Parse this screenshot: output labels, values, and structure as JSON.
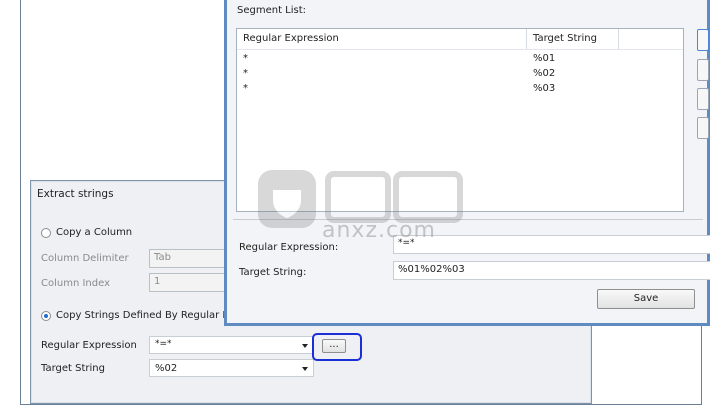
{
  "extract_panel": {
    "title": "Extract strings",
    "copy_column": {
      "label": "Copy a Column",
      "selected": false,
      "column_delimiter": {
        "label": "Column Delimiter",
        "value": "Tab"
      },
      "column_index": {
        "label": "Column Index",
        "value": "1"
      }
    },
    "copy_regex": {
      "label": "Copy Strings Defined By Regular Ex",
      "selected": true,
      "regular_expression": {
        "label": "Regular Expression",
        "value": "*=*"
      },
      "ellipsis_label": "...",
      "target_string": {
        "label": "Target String",
        "value": "%02"
      }
    }
  },
  "segment_dialog": {
    "section_label": "Segment List:",
    "columns": [
      "Regular Expression",
      "Target String"
    ],
    "rows": [
      {
        "regex": "*",
        "target": "%01"
      },
      {
        "regex": "*",
        "target": "%02"
      },
      {
        "regex": "*",
        "target": "%03"
      }
    ],
    "regular_expression": {
      "label": "Regular Expression:",
      "value": "*=*"
    },
    "target_string": {
      "label": "Target String:",
      "value": "%01%02%03"
    },
    "save_label": "Save"
  },
  "watermark": {
    "text": "anxz.com"
  },
  "colors": {
    "highlight": "#1a2fd6",
    "dialog_border": "#5f8bc0",
    "radio_selected": "#1e6fd0"
  }
}
